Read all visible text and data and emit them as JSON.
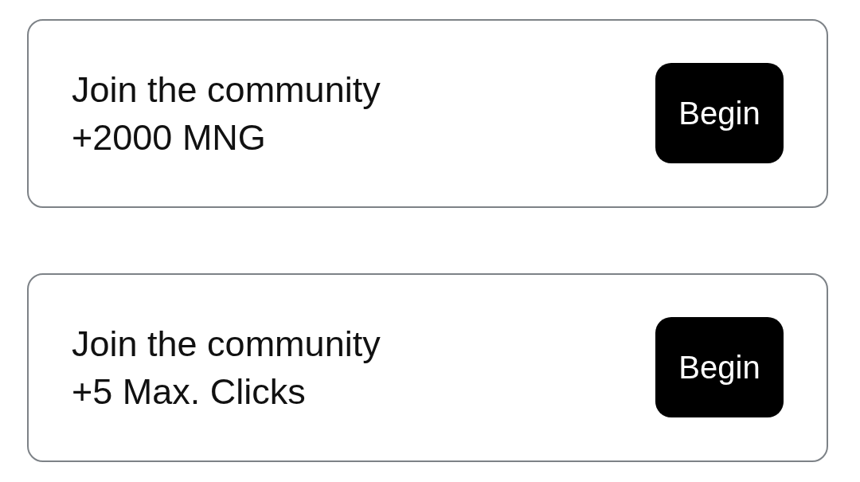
{
  "tasks": [
    {
      "title": "Join the community",
      "reward": "+2000 MNG",
      "button": "Begin"
    },
    {
      "title": "Join the community",
      "reward": "+5 Max. Clicks",
      "button": "Begin"
    }
  ]
}
